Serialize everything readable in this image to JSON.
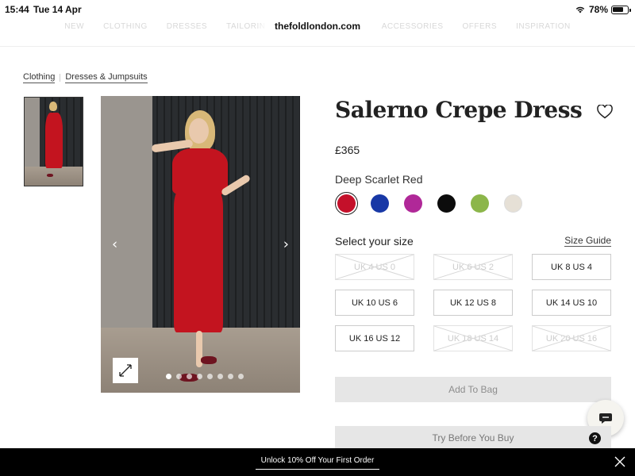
{
  "status_bar": {
    "time": "15:44",
    "date": "Tue 14 Apr",
    "battery": "78%",
    "battery_level": 0.78
  },
  "browser": {
    "url": "thefoldlondon.com"
  },
  "nav": {
    "items": [
      "NEW",
      "CLOTHING",
      "DRESSES",
      "TAILORING",
      "",
      "ACCESSORIES",
      "OFFERS",
      "INSPIRATION"
    ]
  },
  "breadcrumb": {
    "items": [
      "Clothing",
      "Dresses & Jumpsuits"
    ]
  },
  "product": {
    "title": "Salerno Crepe Dress",
    "price": "£365",
    "selected_colour": "Deep Scarlet Red",
    "colours": [
      {
        "name": "Deep Scarlet Red",
        "hex": "#c4102a",
        "selected": true
      },
      {
        "name": "Blue",
        "hex": "#1838a6",
        "selected": false
      },
      {
        "name": "Magenta",
        "hex": "#b02898",
        "selected": false
      },
      {
        "name": "Black",
        "hex": "#0c0c0c",
        "selected": false
      },
      {
        "name": "Green Print",
        "hex": "#8cb64a",
        "selected": false
      },
      {
        "name": "Stone",
        "hex": "#e6e0d6",
        "selected": false
      }
    ],
    "size_label": "Select your size",
    "size_guide": "Size Guide",
    "sizes": [
      {
        "label": "UK 4 US 0",
        "available": false
      },
      {
        "label": "UK 6 US 2",
        "available": false
      },
      {
        "label": "UK 8 US 4",
        "available": true
      },
      {
        "label": "UK 10 US 6",
        "available": true
      },
      {
        "label": "UK 12 US 8",
        "available": true
      },
      {
        "label": "UK 14 US 10",
        "available": true
      },
      {
        "label": "UK 16 US 12",
        "available": true
      },
      {
        "label": "UK 18 US 14",
        "available": false
      },
      {
        "label": "UK 20 US 16",
        "available": false
      }
    ],
    "add_to_bag": "Add To Bag",
    "try_before": "Try Before You Buy",
    "help_icon": "?"
  },
  "gallery": {
    "image_count": 8,
    "active_index": 0
  },
  "icons": {
    "wishlist": "heart-icon",
    "expand": "expand-icon",
    "prev": "chevron-left-icon",
    "next": "chevron-right-icon",
    "chat": "chat-icon",
    "close": "close-icon",
    "wifi": "wifi-icon",
    "battery": "battery-icon"
  },
  "promo": {
    "text": "Unlock 10% Off Your First Order"
  }
}
